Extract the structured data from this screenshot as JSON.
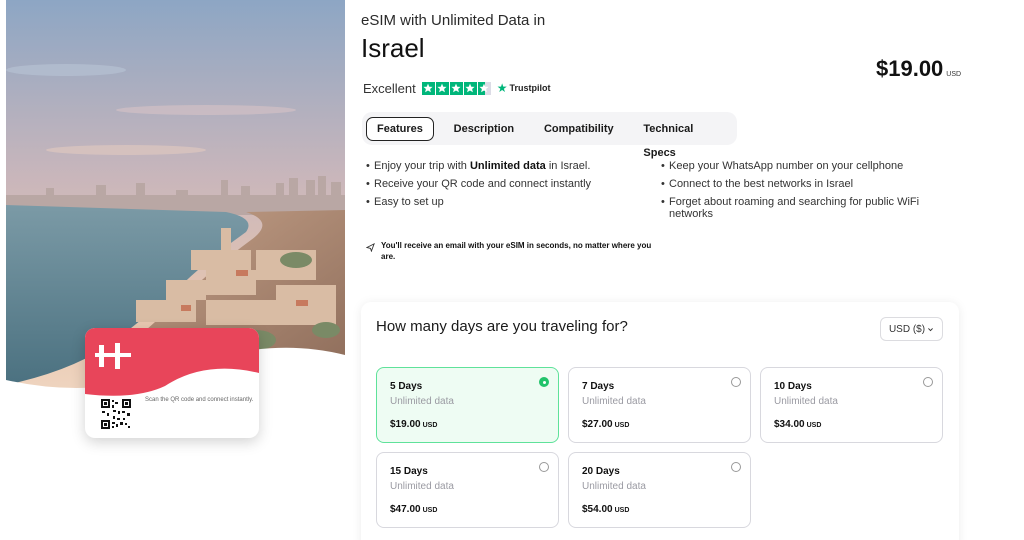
{
  "product": {
    "subtitle": "eSIM with Unlimited Data in",
    "title": "Israel",
    "price": "$19.00",
    "price_currency": "USD"
  },
  "rating": {
    "label": "Excellent",
    "stars": 4.5,
    "provider": "Trustpilot",
    "brand_color": "#00b67a"
  },
  "tabs": [
    {
      "label": "Features",
      "active": true
    },
    {
      "label": "Description",
      "active": false
    },
    {
      "label": "Compatibility",
      "active": false
    },
    {
      "label": "Technical Specs",
      "active": false
    }
  ],
  "features_left": {
    "item0_pre": "Enjoy your trip with ",
    "item0_bold": "Unlimited data",
    "item0_post": " in Israel.",
    "item1": "Receive your QR code and connect instantly",
    "item2": "Easy to set up"
  },
  "features_right": [
    "Keep your WhatsApp number on your cellphone",
    "Connect to the best networks in Israel",
    "Forget about roaming and searching for public WiFi networks"
  ],
  "email_note": "You'll receive an email with your eSIM in seconds, no matter where you are.",
  "esim_card": {
    "note": "Scan the QR code and connect instantly.",
    "brand_color": "#e8455a"
  },
  "picker": {
    "question": "How many days are you traveling for?",
    "currency": "USD ($)",
    "plans": [
      {
        "days": "5 Days",
        "desc": "Unlimited data",
        "price": "$19.00",
        "currency": "USD",
        "selected": true
      },
      {
        "days": "7 Days",
        "desc": "Unlimited data",
        "price": "$27.00",
        "currency": "USD",
        "selected": false
      },
      {
        "days": "10 Days",
        "desc": "Unlimited data",
        "price": "$34.00",
        "currency": "USD",
        "selected": false
      },
      {
        "days": "15 Days",
        "desc": "Unlimited data",
        "price": "$47.00",
        "currency": "USD",
        "selected": false
      },
      {
        "days": "20 Days",
        "desc": "Unlimited data",
        "price": "$54.00",
        "currency": "USD",
        "selected": false
      }
    ],
    "selected_color": "#22c36b"
  }
}
